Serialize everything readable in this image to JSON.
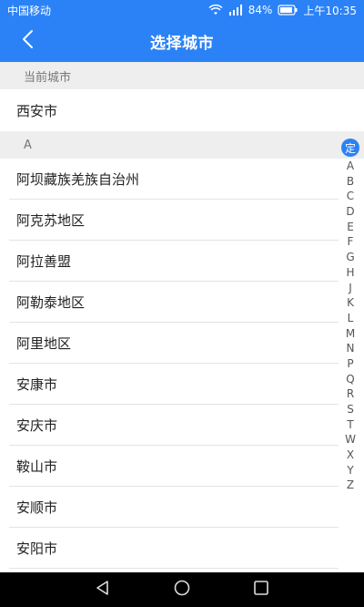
{
  "status_bar": {
    "carrier": "中国移动",
    "signal_type": "2G",
    "battery": "84%",
    "time": "上午10:35"
  },
  "header": {
    "title": "选择城市",
    "back_icon": "chevron-left-icon"
  },
  "current_section": {
    "label": "当前城市",
    "city": "西安市"
  },
  "group": {
    "letter": "A",
    "cities": [
      "阿坝藏族羌族自治州",
      "阿克苏地区",
      "阿拉善盟",
      "阿勒泰地区",
      "阿里地区",
      "安康市",
      "安庆市",
      "鞍山市",
      "安顺市",
      "安阳市"
    ]
  },
  "index_bar": {
    "current": "定",
    "letters": [
      "A",
      "B",
      "C",
      "D",
      "E",
      "F",
      "G",
      "H",
      "J",
      "K",
      "L",
      "M",
      "N",
      "P",
      "Q",
      "R",
      "S",
      "T",
      "W",
      "X",
      "Y",
      "Z"
    ]
  },
  "nav_bar": {
    "back_icon": "triangle-back-icon",
    "home_icon": "circle-home-icon",
    "recents_icon": "square-recents-icon"
  },
  "colors": {
    "primary": "#2b82f7",
    "section_bg": "#eeeeee"
  }
}
